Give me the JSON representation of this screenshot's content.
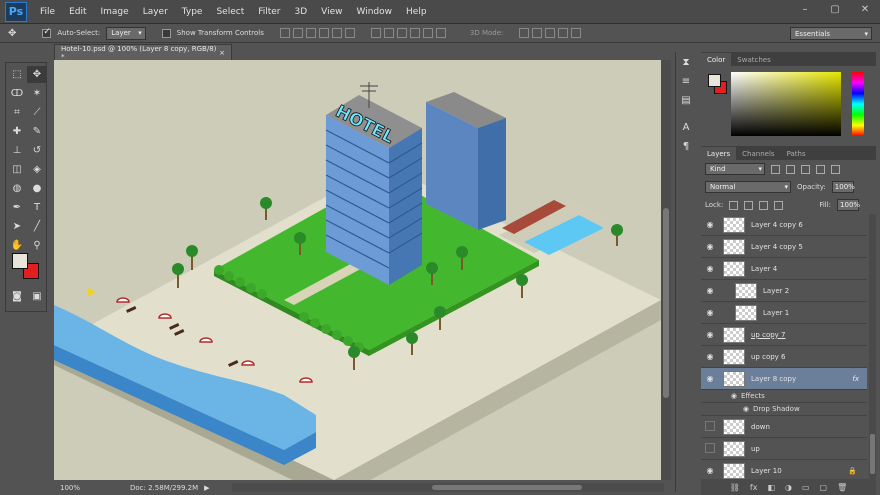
{
  "app": {
    "logo": "Ps"
  },
  "menu": [
    "File",
    "Edit",
    "Image",
    "Layer",
    "Type",
    "Select",
    "Filter",
    "3D",
    "View",
    "Window",
    "Help"
  ],
  "window_controls": [
    "–",
    "▢",
    "✕"
  ],
  "options": {
    "tool_icon": "move-tool-icon",
    "auto_select_label": "Auto-Select:",
    "auto_select_value": "Layer",
    "transform_label": "Show Transform Controls",
    "mode_label": "3D Mode:",
    "workspace": "Essentials"
  },
  "document": {
    "tab_title": "Hotel-10.psd @ 100% (Layer 8 copy, RGB/8) *",
    "close": "×",
    "zoom": "100%",
    "doc_info": "Doc: 2.58M/299.2M",
    "sign_text": "HOTEL"
  },
  "color_panel": {
    "tabs": [
      "Color",
      "Swatches"
    ],
    "fg": "#e9e5d8",
    "bg": "#e31e1e"
  },
  "layers_panel": {
    "tabs": [
      "Layers",
      "Channels",
      "Paths"
    ],
    "kind": "Kind",
    "blend": "Normal",
    "opacity_label": "Opacity:",
    "opacity": "100%",
    "lock_label": "Lock:",
    "fill_label": "Fill:",
    "fill": "100%",
    "layers": [
      {
        "name": "Layer 4 copy 6"
      },
      {
        "name": "Layer 4 copy 5"
      },
      {
        "name": "Layer 4"
      },
      {
        "name": "Layer 2"
      },
      {
        "name": "Layer 1"
      },
      {
        "name": "up copy 7"
      },
      {
        "name": "up copy 6"
      },
      {
        "name": "Layer 8 copy",
        "fx": "fx"
      },
      {
        "name": "down"
      },
      {
        "name": "up"
      },
      {
        "name": "Layer 10"
      }
    ],
    "effects_label": "Effects",
    "drop_shadow_label": "Drop Shadow"
  }
}
